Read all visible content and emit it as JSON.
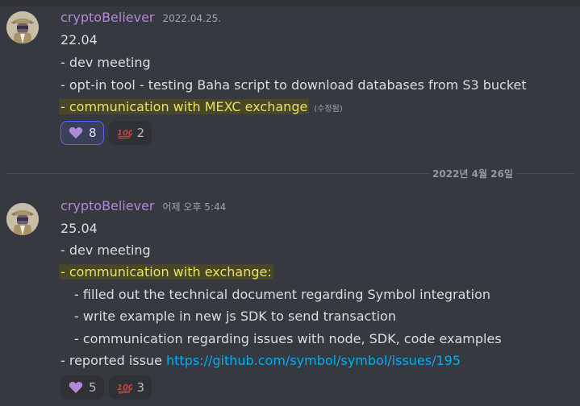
{
  "messages": [
    {
      "author": "cryptoBeliever",
      "timestamp": "2022.04.25.",
      "lines": {
        "l1": "22.04",
        "l2": "- dev meeting",
        "l3": "- opt-in tool - testing Baha script to download databases from S3 bucket",
        "l4": "- communication with MEXC exchange",
        "edited": "(수정됨)"
      },
      "reactions": [
        {
          "icon": "purple-heart-icon",
          "count": "8",
          "color": "#b08ad8"
        },
        {
          "icon": "hundred-points-icon",
          "count": "2",
          "color": "#d83b3b"
        }
      ]
    },
    {
      "author": "cryptoBeliever",
      "timestamp": "어제 오후 5:44",
      "lines": {
        "l1": "25.04",
        "l2": "- dev meeting",
        "l3": "- communication with exchange:",
        "l4": "- filled out the technical document regarding Symbol integration",
        "l5": "- write example in new js SDK to send transaction",
        "l6": "- communication regarding issues with node, SDK, code examples",
        "l7_prefix": "- reported issue ",
        "l7_link": "https://github.com/symbol/symbol/issues/195"
      },
      "reactions": [
        {
          "icon": "purple-heart-icon",
          "count": "5",
          "color": "#b08ad8"
        },
        {
          "icon": "hundred-points-icon",
          "count": "3",
          "color": "#d83b3b"
        }
      ]
    }
  ],
  "date_divider": "2022년 4월 26일",
  "theme": {
    "highlight": "#e8e35f",
    "link": "#00aff4",
    "author": "#b388d6"
  }
}
